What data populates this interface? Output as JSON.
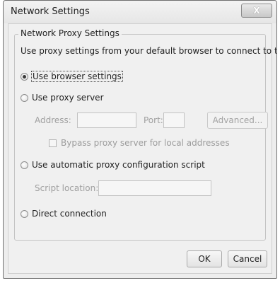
{
  "window": {
    "title": "Network Settings",
    "close_label": "X"
  },
  "group": {
    "legend": "Network Proxy Settings",
    "description": "Use proxy settings from your default browser to connect to the Internet."
  },
  "options": {
    "browser": "Use browser settings",
    "proxy_server": "Use proxy server",
    "automatic": "Use automatic proxy configuration script",
    "direct": "Direct connection"
  },
  "selected_option": "browser",
  "proxy": {
    "address_label": "Address:",
    "address_value": "",
    "port_label": "Port:",
    "port_value": "",
    "advanced_label": "Advanced...",
    "bypass_label": "Bypass proxy server for local addresses",
    "bypass_checked": false
  },
  "script": {
    "location_label": "Script location:",
    "location_value": ""
  },
  "buttons": {
    "ok": "OK",
    "cancel": "Cancel"
  }
}
